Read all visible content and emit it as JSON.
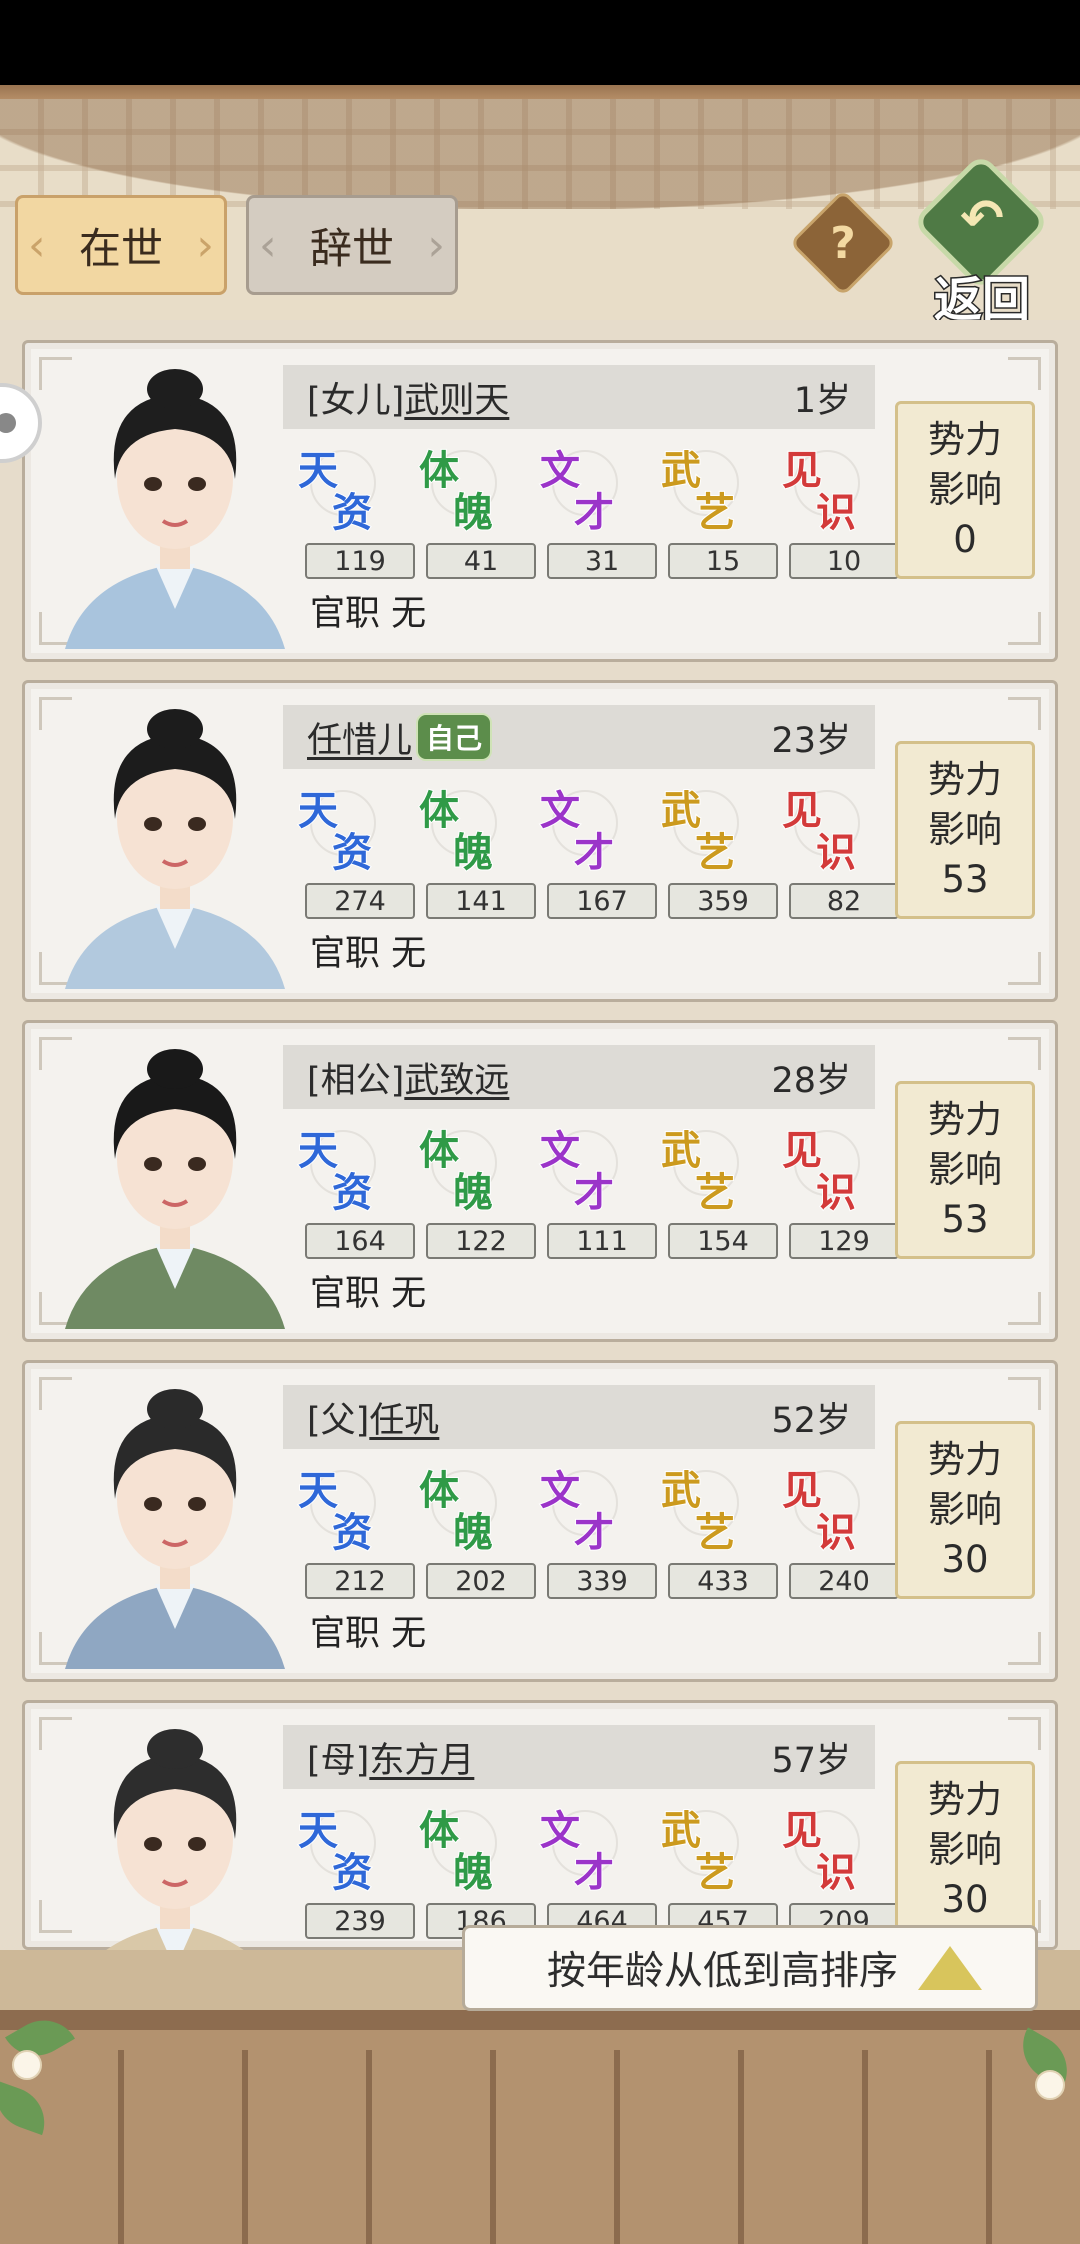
{
  "tabs": {
    "alive": "在世",
    "dead": "辞世"
  },
  "help_label": "?",
  "back_label": "返回",
  "influence_title": [
    "势力",
    "影响"
  ],
  "office_label": "官职",
  "stat_labels": [
    {
      "a": "天",
      "b": "资",
      "color": "#2f68d8"
    },
    {
      "a": "体",
      "b": "魄",
      "color": "#2f9a47"
    },
    {
      "a": "文",
      "b": "才",
      "color": "#9b34c9"
    },
    {
      "a": "武",
      "b": "艺",
      "color": "#cc9a1e"
    },
    {
      "a": "见",
      "b": "识",
      "color": "#d33a3a"
    }
  ],
  "self_badge": "自己",
  "people": [
    {
      "relation": "[女儿]",
      "name": "武则天",
      "age": "1岁",
      "is_self": false,
      "stats": [
        "119",
        "41",
        "31",
        "15",
        "10"
      ],
      "office": "无",
      "influence": "0"
    },
    {
      "relation": "",
      "name": "任惜儿",
      "age": "23岁",
      "is_self": true,
      "stats": [
        "274",
        "141",
        "167",
        "359",
        "82"
      ],
      "office": "无",
      "influence": "53"
    },
    {
      "relation": "[相公]",
      "name": "武致远",
      "age": "28岁",
      "is_self": false,
      "stats": [
        "164",
        "122",
        "111",
        "154",
        "129"
      ],
      "office": "无",
      "influence": "53"
    },
    {
      "relation": "[父]",
      "name": "任巩",
      "age": "52岁",
      "is_self": false,
      "stats": [
        "212",
        "202",
        "339",
        "433",
        "240"
      ],
      "office": "无",
      "influence": "30"
    },
    {
      "relation": "[母]",
      "name": "东方月",
      "age": "57岁",
      "is_self": false,
      "stats": [
        "239",
        "186",
        "464",
        "457",
        "209"
      ],
      "office": "",
      "influence": "30"
    }
  ],
  "sort_label": "按年龄从低到高排序"
}
